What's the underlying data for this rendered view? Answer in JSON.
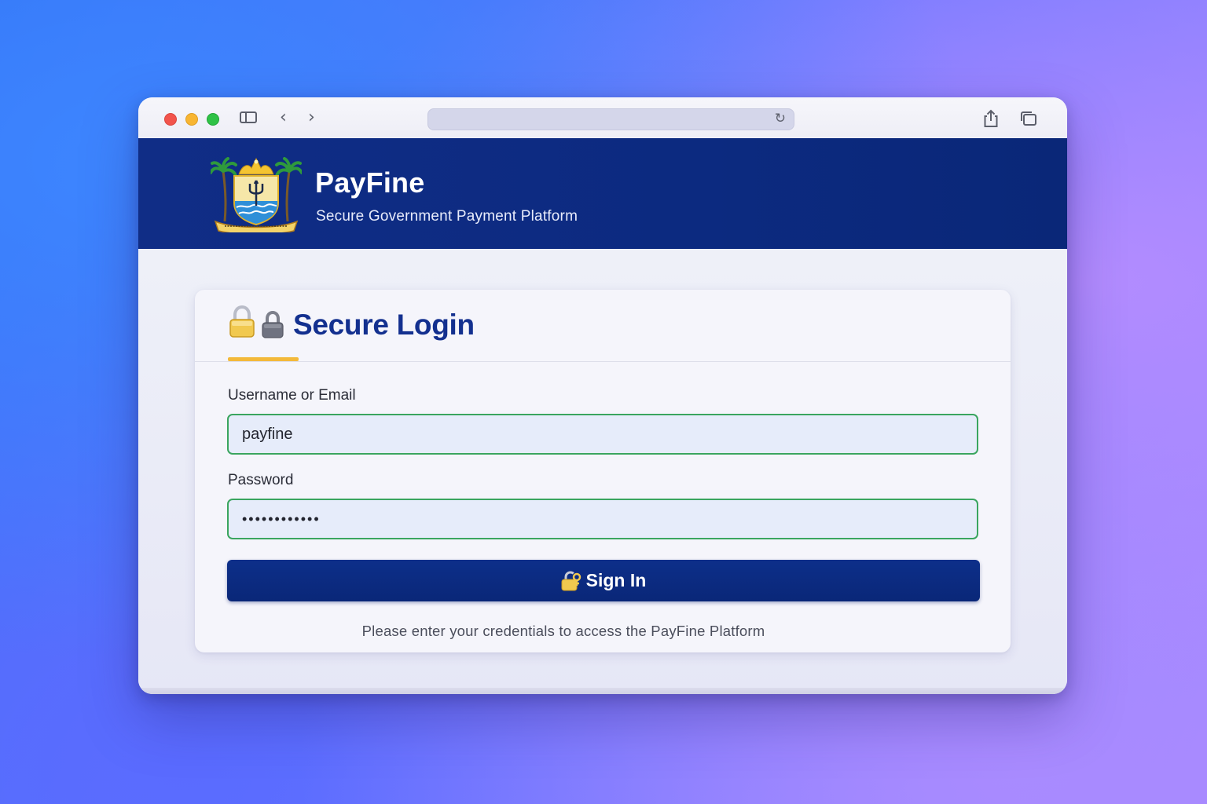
{
  "browser": {
    "address": ""
  },
  "header": {
    "title": "PayFine",
    "subtitle": "Secure Government Payment Platform",
    "colors": {
      "background": "#0c2a80",
      "accent": "#f3b93a"
    }
  },
  "login": {
    "title": "Secure Login",
    "username_label": "Username or Email",
    "username_value": "payfine",
    "password_label": "Password",
    "password_value": "••••••••••••",
    "submit_label": "Sign In",
    "help_text": "Please enter your credentials to access the PayFine Platform",
    "colors": {
      "title": "#13308f",
      "input_border": "#3aa55f",
      "button": "#0c2a80"
    },
    "icons": [
      "gold-lock-icon",
      "lock-icon",
      "key-lock-icon"
    ]
  }
}
